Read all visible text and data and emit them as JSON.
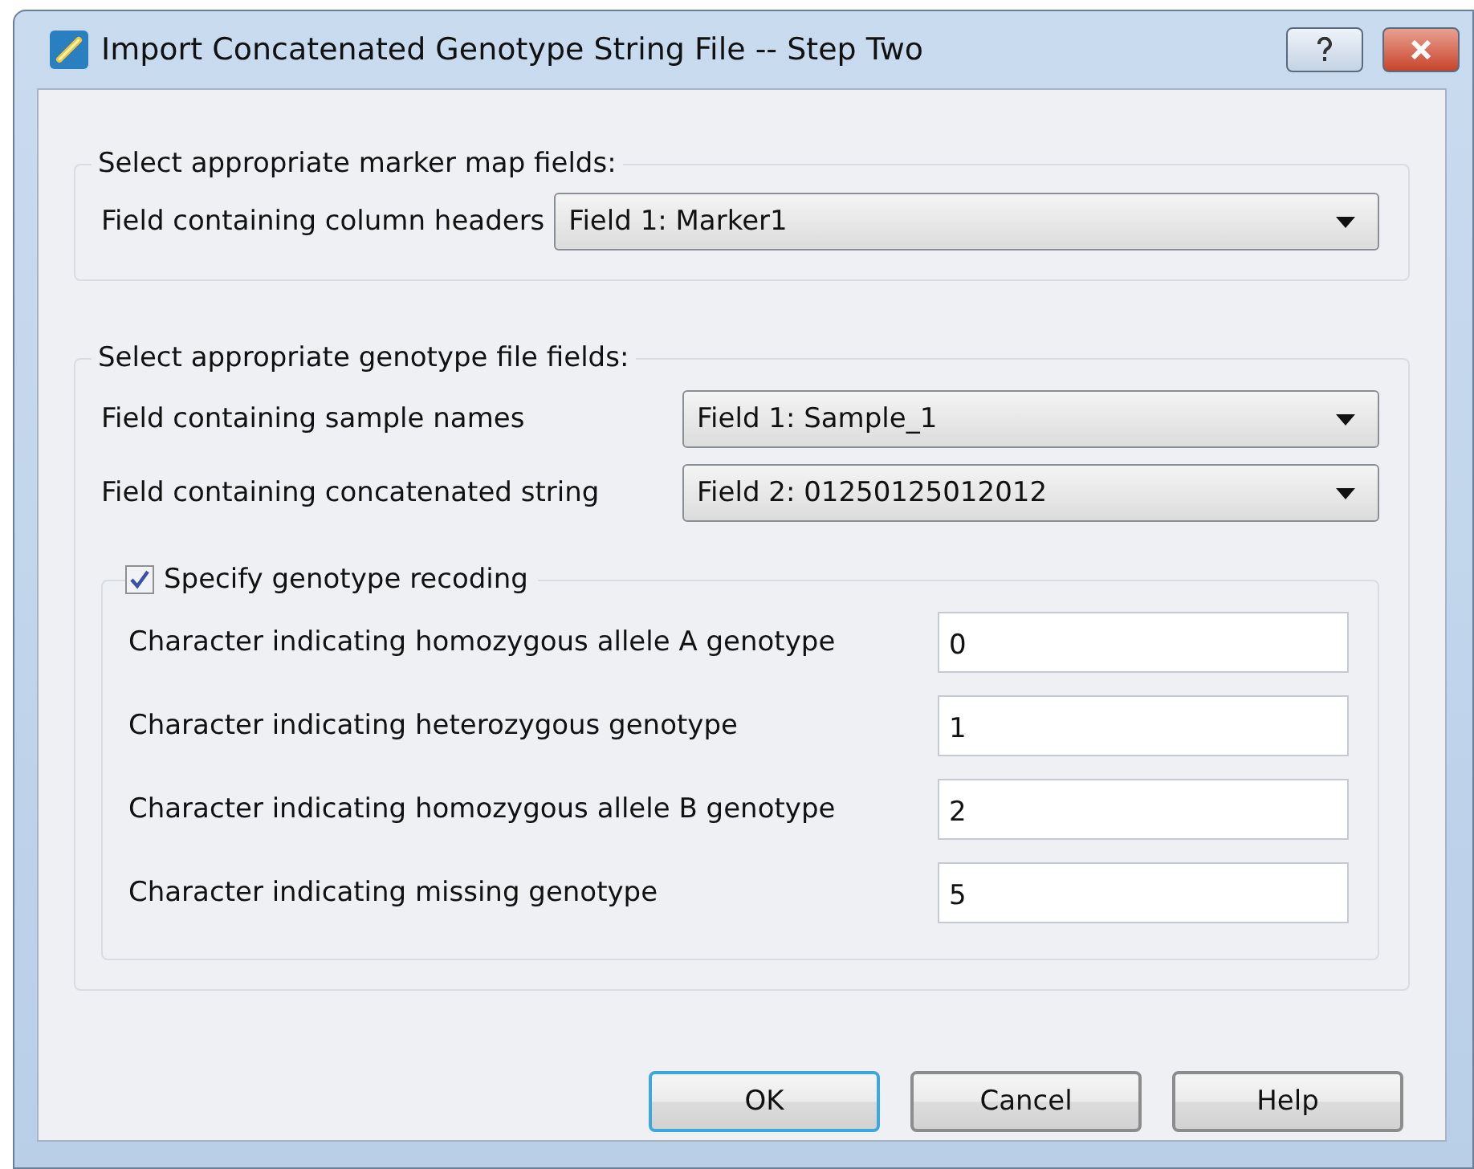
{
  "window": {
    "title": "Import Concatenated Genotype String File -- Step Two"
  },
  "marker_map": {
    "title": "Select appropriate marker map fields:",
    "fields": [
      {
        "label": "Field containing column headers",
        "value": "Field 1: Marker1"
      }
    ]
  },
  "genotype_file": {
    "title": "Select appropriate genotype file fields:",
    "fields": [
      {
        "label": "Field containing sample names",
        "value": "Field 1: Sample_1"
      },
      {
        "label": "Field containing concatenated string",
        "value": "Field 2: 01250125012012"
      }
    ],
    "recoding": {
      "label": "Specify genotype recoding",
      "checked": true,
      "fields": [
        {
          "label": "Character indicating homozygous allele A genotype",
          "value": "0"
        },
        {
          "label": "Character indicating heterozygous genotype",
          "value": "1"
        },
        {
          "label": "Character indicating homozygous allele B genotype",
          "value": "2"
        },
        {
          "label": "Character indicating missing genotype",
          "value": "5"
        }
      ]
    }
  },
  "buttons": [
    {
      "label": "OK",
      "default": true
    },
    {
      "label": "Cancel",
      "default": false
    },
    {
      "label": "Help",
      "default": false
    }
  ]
}
